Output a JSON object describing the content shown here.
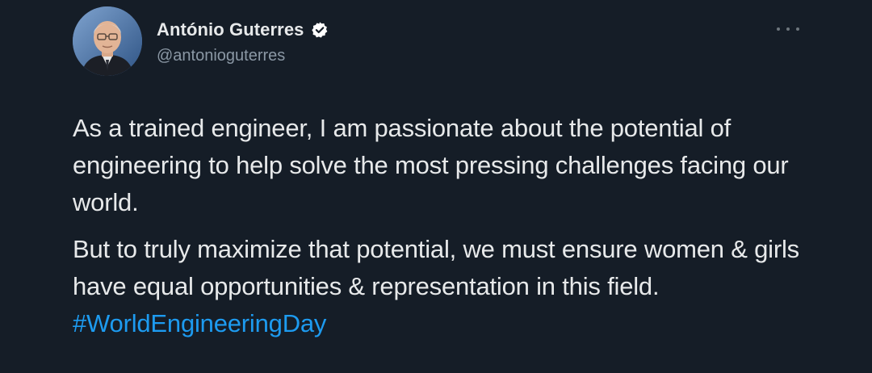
{
  "author": {
    "display_name": "António Guterres",
    "handle": "@antonioguterres",
    "verified": true,
    "avatar_icon": "person-portrait-icon"
  },
  "tweet": {
    "paragraph_1": "As a trained engineer, I am passionate about the potential of engineering to help solve the most pressing challenges facing our world.",
    "paragraph_2": "But to truly maximize that potential, we must ensure women & girls have equal opportunities & representation in this field.",
    "hashtag": "#WorldEngineeringDay"
  },
  "colors": {
    "background": "#151d27",
    "text": "#e7e9ea",
    "secondary_text": "#8b98a5",
    "link": "#1d9bf0"
  }
}
